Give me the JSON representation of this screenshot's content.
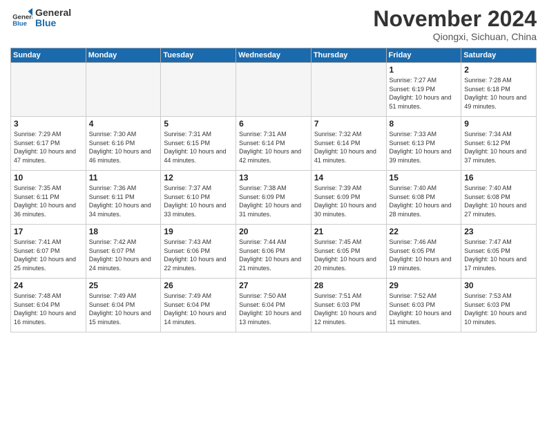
{
  "header": {
    "logo_general": "General",
    "logo_blue": "Blue",
    "month_title": "November 2024",
    "location": "Qiongxi, Sichuan, China"
  },
  "weekdays": [
    "Sunday",
    "Monday",
    "Tuesday",
    "Wednesday",
    "Thursday",
    "Friday",
    "Saturday"
  ],
  "weeks": [
    [
      {
        "day": "",
        "info": ""
      },
      {
        "day": "",
        "info": ""
      },
      {
        "day": "",
        "info": ""
      },
      {
        "day": "",
        "info": ""
      },
      {
        "day": "",
        "info": ""
      },
      {
        "day": "1",
        "info": "Sunrise: 7:27 AM\nSunset: 6:19 PM\nDaylight: 10 hours and 51 minutes."
      },
      {
        "day": "2",
        "info": "Sunrise: 7:28 AM\nSunset: 6:18 PM\nDaylight: 10 hours and 49 minutes."
      }
    ],
    [
      {
        "day": "3",
        "info": "Sunrise: 7:29 AM\nSunset: 6:17 PM\nDaylight: 10 hours and 47 minutes."
      },
      {
        "day": "4",
        "info": "Sunrise: 7:30 AM\nSunset: 6:16 PM\nDaylight: 10 hours and 46 minutes."
      },
      {
        "day": "5",
        "info": "Sunrise: 7:31 AM\nSunset: 6:15 PM\nDaylight: 10 hours and 44 minutes."
      },
      {
        "day": "6",
        "info": "Sunrise: 7:31 AM\nSunset: 6:14 PM\nDaylight: 10 hours and 42 minutes."
      },
      {
        "day": "7",
        "info": "Sunrise: 7:32 AM\nSunset: 6:14 PM\nDaylight: 10 hours and 41 minutes."
      },
      {
        "day": "8",
        "info": "Sunrise: 7:33 AM\nSunset: 6:13 PM\nDaylight: 10 hours and 39 minutes."
      },
      {
        "day": "9",
        "info": "Sunrise: 7:34 AM\nSunset: 6:12 PM\nDaylight: 10 hours and 37 minutes."
      }
    ],
    [
      {
        "day": "10",
        "info": "Sunrise: 7:35 AM\nSunset: 6:11 PM\nDaylight: 10 hours and 36 minutes."
      },
      {
        "day": "11",
        "info": "Sunrise: 7:36 AM\nSunset: 6:11 PM\nDaylight: 10 hours and 34 minutes."
      },
      {
        "day": "12",
        "info": "Sunrise: 7:37 AM\nSunset: 6:10 PM\nDaylight: 10 hours and 33 minutes."
      },
      {
        "day": "13",
        "info": "Sunrise: 7:38 AM\nSunset: 6:09 PM\nDaylight: 10 hours and 31 minutes."
      },
      {
        "day": "14",
        "info": "Sunrise: 7:39 AM\nSunset: 6:09 PM\nDaylight: 10 hours and 30 minutes."
      },
      {
        "day": "15",
        "info": "Sunrise: 7:40 AM\nSunset: 6:08 PM\nDaylight: 10 hours and 28 minutes."
      },
      {
        "day": "16",
        "info": "Sunrise: 7:40 AM\nSunset: 6:08 PM\nDaylight: 10 hours and 27 minutes."
      }
    ],
    [
      {
        "day": "17",
        "info": "Sunrise: 7:41 AM\nSunset: 6:07 PM\nDaylight: 10 hours and 25 minutes."
      },
      {
        "day": "18",
        "info": "Sunrise: 7:42 AM\nSunset: 6:07 PM\nDaylight: 10 hours and 24 minutes."
      },
      {
        "day": "19",
        "info": "Sunrise: 7:43 AM\nSunset: 6:06 PM\nDaylight: 10 hours and 22 minutes."
      },
      {
        "day": "20",
        "info": "Sunrise: 7:44 AM\nSunset: 6:06 PM\nDaylight: 10 hours and 21 minutes."
      },
      {
        "day": "21",
        "info": "Sunrise: 7:45 AM\nSunset: 6:05 PM\nDaylight: 10 hours and 20 minutes."
      },
      {
        "day": "22",
        "info": "Sunrise: 7:46 AM\nSunset: 6:05 PM\nDaylight: 10 hours and 19 minutes."
      },
      {
        "day": "23",
        "info": "Sunrise: 7:47 AM\nSunset: 6:05 PM\nDaylight: 10 hours and 17 minutes."
      }
    ],
    [
      {
        "day": "24",
        "info": "Sunrise: 7:48 AM\nSunset: 6:04 PM\nDaylight: 10 hours and 16 minutes."
      },
      {
        "day": "25",
        "info": "Sunrise: 7:49 AM\nSunset: 6:04 PM\nDaylight: 10 hours and 15 minutes."
      },
      {
        "day": "26",
        "info": "Sunrise: 7:49 AM\nSunset: 6:04 PM\nDaylight: 10 hours and 14 minutes."
      },
      {
        "day": "27",
        "info": "Sunrise: 7:50 AM\nSunset: 6:04 PM\nDaylight: 10 hours and 13 minutes."
      },
      {
        "day": "28",
        "info": "Sunrise: 7:51 AM\nSunset: 6:03 PM\nDaylight: 10 hours and 12 minutes."
      },
      {
        "day": "29",
        "info": "Sunrise: 7:52 AM\nSunset: 6:03 PM\nDaylight: 10 hours and 11 minutes."
      },
      {
        "day": "30",
        "info": "Sunrise: 7:53 AM\nSunset: 6:03 PM\nDaylight: 10 hours and 10 minutes."
      }
    ]
  ]
}
